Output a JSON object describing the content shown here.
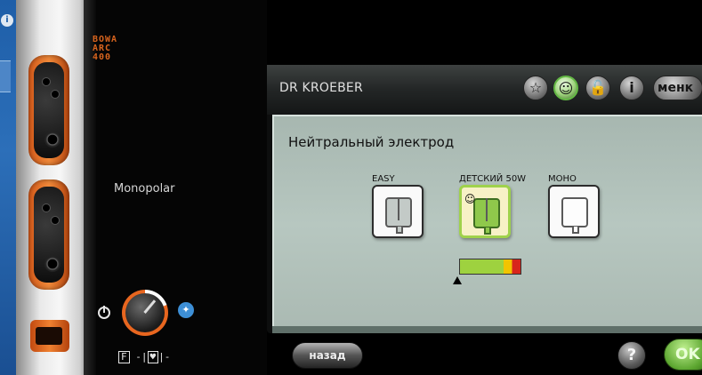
{
  "device": {
    "logo_lines": [
      "BOWA",
      "ARC",
      "400"
    ],
    "mode_label": "Monopolar",
    "footer_letter": "F",
    "footer_symbol": "♥"
  },
  "screen": {
    "owner": "DR KROEBER",
    "menu_label": "менк",
    "toolbar_icons": [
      "star-icon",
      "child-icon",
      "lock-icon",
      "info-icon"
    ],
    "title": "Нейтральный электрод",
    "options": [
      {
        "label": "EASY",
        "icon": "split-pad-icon",
        "selected": false
      },
      {
        "label": "ДЕТСКИЙ 50W",
        "icon": "child-pad-icon",
        "selected": true
      },
      {
        "label": "МОНО",
        "icon": "mono-pad-icon",
        "selected": false
      }
    ],
    "power_level": 0.72,
    "back_label": "назад",
    "help_label": "?",
    "ok_label": "OK"
  },
  "colors": {
    "accent_orange": "#e8661f",
    "screen_bg": "#b0c0b9",
    "ok_green": "#5ba52f",
    "selected_border": "#9fd24b",
    "power_green": "#9ed23f",
    "power_yellow": "#f2c400",
    "power_red": "#d8261c"
  }
}
